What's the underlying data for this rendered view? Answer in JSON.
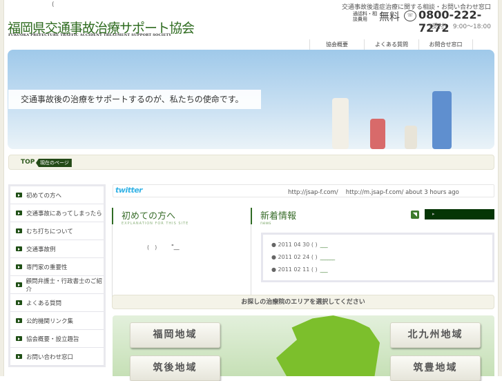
{
  "header": {
    "paren": "(",
    "title": "福岡県交通事故治療サポート協会",
    "subtitle": "FUKUOKA PREFECTURE TRAFFIC ACCIDENT TREATMENT SUPPORT SOCIETY",
    "tagline": "交通事故後遺症治療に関する相談・お問い合わせ窓口",
    "fee_label": "通話料・相談費用",
    "free": "無料",
    "phone_icon": "free-dial",
    "phone": "0800-222-7272",
    "hours": "(受付)　9:00〜18:00"
  },
  "nav": [
    "協会概要",
    "よくある質問",
    "お問合せ窓口"
  ],
  "hero": {
    "banner": "交通事故後の治療をサポートするのが、私たちの使命です。"
  },
  "breadcrumb": {
    "top": "TOP",
    "current": "現在のページ"
  },
  "sidebar": {
    "items": [
      "初めての方へ",
      "交通事故にあってしまったら",
      "むち打ちについて",
      "交通事故例",
      "専門家の重要性",
      "顧問弁護士・行政書士のご紹介",
      "よくある質問",
      "公的機関リンク集",
      "協会概要・設立趣旨",
      "お問い合わせ窓口"
    ]
  },
  "twitter": {
    "logo": "twitter",
    "text": "http://jsap-f.com/　 http://m.jsap-f.com/ about 3 hours ago"
  },
  "intro": {
    "title": "初めての方へ",
    "subtitle": "EXPLANATION FOR THIS SITE",
    "body": "(　)",
    "link": "\"__"
  },
  "news": {
    "title": "新着情報",
    "subtitle": "news",
    "more": "▸",
    "items": [
      {
        "date": "2011 04 30 ( )",
        "link": "___"
      },
      {
        "date": "2011 02 24 ( )",
        "link": "______"
      },
      {
        "date": "2011 02 11 ( )",
        "link": "___"
      }
    ]
  },
  "area": {
    "prompt": "お探しの治療院のエリアを選択してください",
    "buttons": [
      "福岡地域",
      "筑後地域",
      "北九州地域",
      "筑豊地域"
    ]
  },
  "colors": {
    "brand": "#2e6b1f",
    "dark": "#053505",
    "twitter": "#35b3e6"
  }
}
